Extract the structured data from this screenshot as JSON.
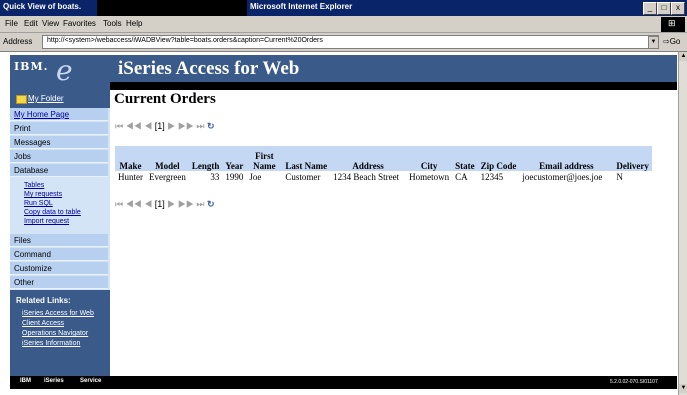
{
  "window": {
    "title_left": "Quick View of boats.",
    "title_right": "Microsoft Internet Explorer",
    "controls": [
      "_",
      "□",
      "x"
    ]
  },
  "menu": [
    "File",
    "Edit",
    "View",
    "Favorites",
    "Tools",
    "Help"
  ],
  "address": {
    "label": "Address",
    "value": "http://<system>/webaccess/iWADBView?table=boats.orders&caption=Current%20Orders",
    "go": "Go"
  },
  "header": {
    "ibm_logo": "IBM.",
    "e_logo": "e",
    "title": "iSeries Access for Web"
  },
  "sidebar": {
    "folder": "My Folder",
    "items": [
      "My Home Page",
      "Print",
      "Messages",
      "Jobs",
      "Database"
    ],
    "sub_items": [
      "Tables",
      "My requests",
      "Run SQL",
      "Copy data to table",
      "Import request"
    ],
    "items_after": [
      "Files",
      "Command",
      "Customize",
      "Other"
    ],
    "related_title": "Related Links:",
    "related_links": [
      "iSeries Access for Web",
      "Client Access",
      "Operations Navigator",
      "iSeries Information"
    ]
  },
  "main": {
    "page_title": "Current Orders",
    "pager": {
      "first": "⏮",
      "prev_page": "◀◀",
      "prev": "◀",
      "current": "[1]",
      "next": "▶",
      "next_page": "▶▶",
      "last": "⏭"
    },
    "table": {
      "headers": [
        "Make",
        "Model",
        "Length",
        "Year",
        "First Name",
        "Last Name",
        "Address",
        "City",
        "State",
        "Zip Code",
        "Email address",
        "Delivery"
      ],
      "rows": [
        [
          "Hunter",
          "Evergreen",
          "33",
          "1990",
          "Joe",
          "Customer",
          "1234 Beach Street",
          "Hometown",
          "CA",
          "12345",
          "joecustomer@joes.joe",
          "N"
        ]
      ]
    }
  },
  "status": {
    "ibm": "IBM",
    "iseries": "iSeries",
    "service": "Service",
    "right": "5.2.0.02-070.SI01107"
  }
}
